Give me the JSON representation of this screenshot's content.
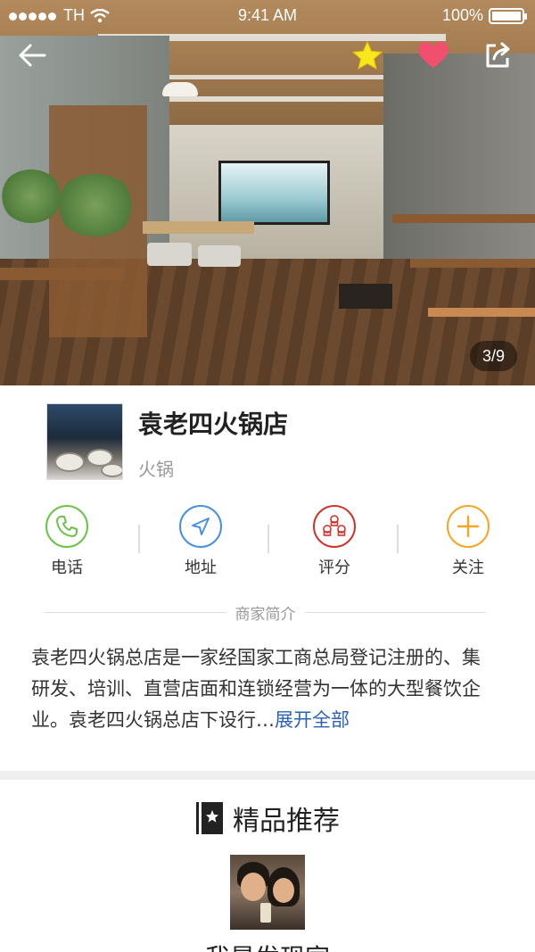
{
  "status_bar": {
    "carrier": "TH",
    "time": "9:41 AM",
    "battery": "100%"
  },
  "hero": {
    "page_indicator": "3/9"
  },
  "shop": {
    "name": "袁老四火锅店",
    "category": "火锅"
  },
  "actions": [
    {
      "label": "电话",
      "icon": "phone-icon",
      "color": "#6cc24a"
    },
    {
      "label": "地址",
      "icon": "location-arrow-icon",
      "color": "#4a90e2"
    },
    {
      "label": "评分",
      "icon": "chef-hats-icon",
      "color": "#d0342c"
    },
    {
      "label": "关注",
      "icon": "plus-icon",
      "color": "#f5a623"
    }
  ],
  "intro": {
    "heading": "商家简介",
    "text": "袁老四火锅总店是一家经国家工商总局登记注册的、集研发、培训、直营店面和连锁经营为一体的大型餐饮企业。袁老四火锅总店下设行…",
    "more": "展开全部"
  },
  "recommend": {
    "title": "精品推荐",
    "name": "我是发现家"
  },
  "colors": {
    "favorite_star": "#f8e71c",
    "favorite_heart": "#f0506e",
    "link": "#2c62b8"
  }
}
